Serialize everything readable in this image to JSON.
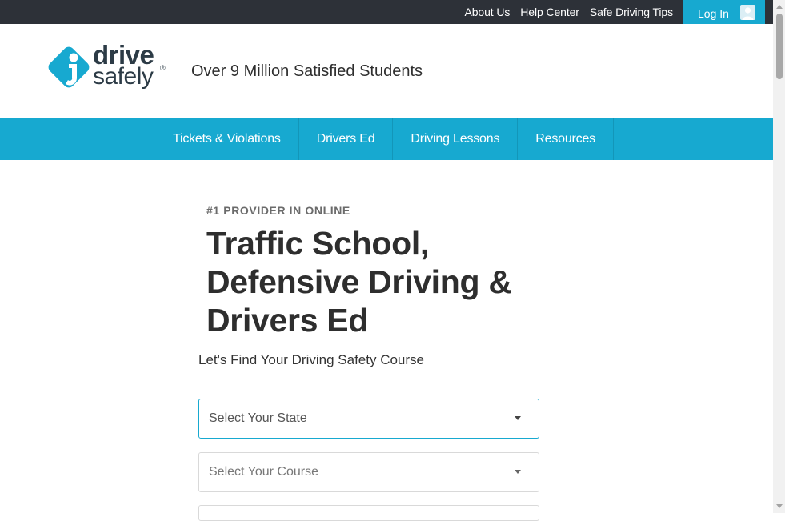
{
  "topbar": {
    "links": [
      "About Us",
      "Help Center",
      "Safe Driving Tips"
    ],
    "login_label": "Log In"
  },
  "logo": {
    "line1": "drive",
    "line2": "safely",
    "registered": "®",
    "brand_color": "#17a9d0"
  },
  "header": {
    "tagline": "Over 9 Million Satisfied Students"
  },
  "nav": {
    "items": [
      "Tickets & Violations",
      "Drivers Ed",
      "Driving Lessons",
      "Resources"
    ]
  },
  "hero": {
    "eyebrow": "#1 PROVIDER IN ONLINE",
    "headline_line1": "Traffic School,",
    "headline_line2": "Defensive Driving &",
    "headline_line3": "Drivers Ed",
    "subhead": "Let's Find Your Driving Safety Course"
  },
  "form": {
    "state_select": "Select Your State",
    "course_select": "Select Your Course"
  },
  "colors": {
    "topbar": "#2d3138",
    "accent": "#17a9d0"
  }
}
